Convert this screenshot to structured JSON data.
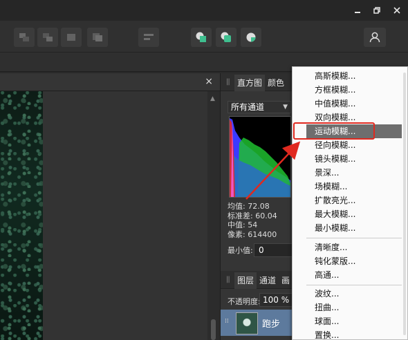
{
  "colors": {
    "accent_red": "#e0291f",
    "highlight": "#6e6e6e",
    "layer_selected": "#5d7a9d"
  },
  "window": {
    "minimize_icon": "minimize-icon",
    "restore_icon": "restore-icon",
    "close_icon": "close-icon"
  },
  "document": {
    "close_glyph": "×"
  },
  "panel": {
    "tabs": [
      "直方图",
      "颜色"
    ],
    "channel_select": "所有通道",
    "stats": {
      "mean": "均值: 72.08",
      "stddev": "标准差: 60.04",
      "median": "中值: 54",
      "pixels": "像素: 614400"
    },
    "min_label": "最小值:",
    "min_value": "0"
  },
  "layers": {
    "tabs": [
      "图层",
      "通道",
      "画"
    ],
    "opacity_label": "不透明度:",
    "opacity_value": "100 %",
    "layer_name": "跑步"
  },
  "menu": {
    "items": [
      "高斯模糊...",
      "方框模糊...",
      "中值模糊...",
      "双向模糊...",
      "运动模糊...",
      "径向模糊...",
      "镜头模糊...",
      "景深...",
      "场模糊...",
      "扩散亮光...",
      "最大模糊...",
      "最小模糊...",
      "清晰度...",
      "钝化蒙版...",
      "高通...",
      "波纹...",
      "扭曲...",
      "球面...",
      "置换..."
    ],
    "highlighted": "运动模糊..."
  }
}
